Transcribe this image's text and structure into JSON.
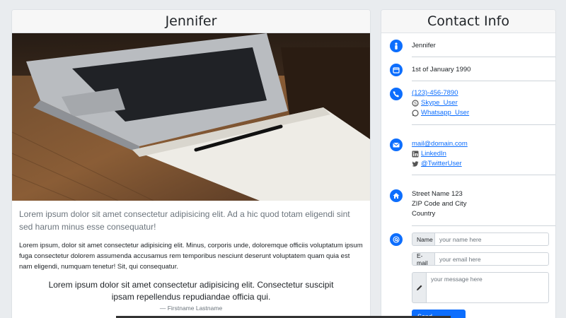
{
  "profile": {
    "name": "Jennifer",
    "lead": "Lorem ipsum dolor sit amet consectetur adipisicing elit. Ad a hic quod totam eligendi sint sed harum minus esse consequatur!",
    "paragraph": "Lorem ipsum, dolor sit amet consectetur adipisicing elit. Minus, corporis unde, doloremque officiis voluptatum ipsum fuga consectetur dolorem assumenda accusamus rem temporibus nesciunt deserunt voluptatem quam quia est nam eligendi, numquam tenetur! Sit, qui consequatur.",
    "quote": "Lorem ipsum dolor sit amet consectetur adipisicing elit. Consectetur suscipit ipsam repellendus repudiandae officia qui.",
    "quote_author": "— Firstname Lastname"
  },
  "contact": {
    "title": "Contact Info",
    "name": "Jennifer",
    "birthday": "1st of January 1990",
    "phone": "(123)-456-7890",
    "skype": "Skype_User",
    "whatsapp": "Whatsapp_User",
    "email": "mail@domain.com",
    "linkedin": "LinkedIn",
    "twitter": "@TwitterUser",
    "address": [
      "Street Name 123",
      "ZIP Code and City",
      "Country"
    ],
    "form": {
      "name_label": "Name",
      "name_placeholder": "your name here",
      "email_label": "E-mail",
      "email_placeholder": "your email here",
      "message_placeholder": "your message here",
      "send_label": "Send Message"
    }
  },
  "colors": {
    "accent": "#0d6efd"
  },
  "icons": [
    "user-icon",
    "calendar-icon",
    "phone-icon",
    "skype-icon",
    "whatsapp-icon",
    "envelope-icon",
    "linkedin-icon",
    "twitter-icon",
    "home-icon",
    "at-icon",
    "pencil-icon"
  ]
}
